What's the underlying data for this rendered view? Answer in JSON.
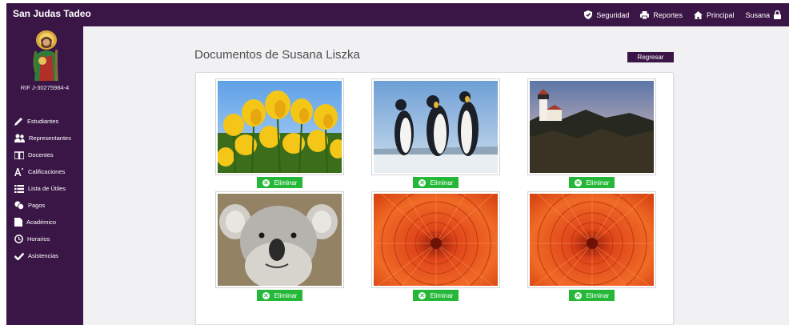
{
  "app": {
    "brand": "San Judas Tadeo"
  },
  "topnav": {
    "items": [
      {
        "label": "Seguridad",
        "icon": "shield-icon"
      },
      {
        "label": "Reportes",
        "icon": "printer-icon"
      },
      {
        "label": "Principal",
        "icon": "home-icon"
      }
    ],
    "user": "Susana",
    "user_icon": "lock-icon"
  },
  "sidebar": {
    "rif": "RIF J-30275984-4",
    "items": [
      {
        "label": "Estudiantes",
        "icon": "pencil-icon"
      },
      {
        "label": "Representantes",
        "icon": "users-icon"
      },
      {
        "label": "Docentes",
        "icon": "book-icon"
      },
      {
        "label": "Calificaciones",
        "icon": "font-icon"
      },
      {
        "label": "Lista de Útiles",
        "icon": "list-icon"
      },
      {
        "label": "Pagos",
        "icon": "coins-icon"
      },
      {
        "label": "Académico",
        "icon": "file-icon"
      },
      {
        "label": "Horarios",
        "icon": "clock-icon"
      },
      {
        "label": "Asistencias",
        "icon": "check-icon"
      }
    ]
  },
  "main": {
    "title": "Documentos de Susana Liszka",
    "back_label": "Regresar",
    "documents": [
      {
        "image": "tulips-photo",
        "delete_label": "Eliminar"
      },
      {
        "image": "penguins-photo",
        "delete_label": "Eliminar"
      },
      {
        "image": "lighthouse-photo",
        "delete_label": "Eliminar"
      },
      {
        "image": "koala-photo",
        "delete_label": "Eliminar"
      },
      {
        "image": "chrysanthemum-photo",
        "delete_label": "Eliminar"
      },
      {
        "image": "chrysanthemum-photo",
        "delete_label": "Eliminar"
      }
    ]
  },
  "colors": {
    "brand": "#3a1646",
    "delete": "#25b838",
    "background": "#f1f0f2"
  }
}
